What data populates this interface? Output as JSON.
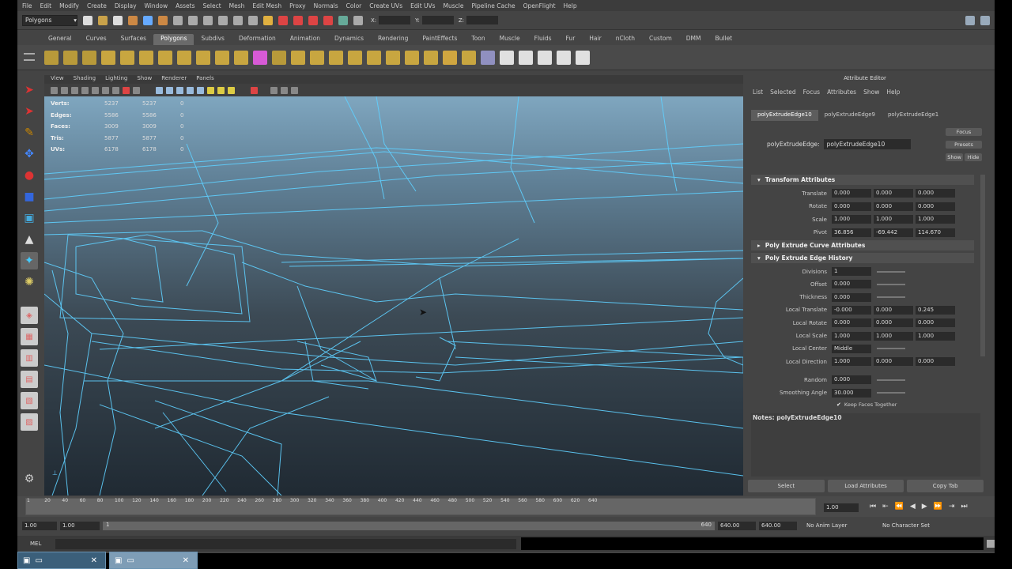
{
  "menubar": [
    "File",
    "Edit",
    "Modify",
    "Create",
    "Display",
    "Window",
    "Assets",
    "Select",
    "Mesh",
    "Edit Mesh",
    "Proxy",
    "Normals",
    "Color",
    "Create UVs",
    "Edit UVs",
    "Muscle",
    "Pipeline Cache",
    "OpenFlight",
    "Help"
  ],
  "status_line": {
    "mode": "Polygons",
    "x_label": "X:",
    "y_label": "Y:",
    "z_label": "Z:"
  },
  "shelf_tabs": [
    "General",
    "Curves",
    "Surfaces",
    "Polygons",
    "Subdivs",
    "Deformation",
    "Animation",
    "Dynamics",
    "Rendering",
    "PaintEffects",
    "Toon",
    "Muscle",
    "Fluids",
    "Fur",
    "Hair",
    "nCloth",
    "Custom",
    "DMM",
    "Bullet"
  ],
  "shelf_active": "Polygons",
  "shelf_icon_colors": [
    "#b89a3a",
    "#b89a3a",
    "#b89a3a",
    "#c8a640",
    "#c8a640",
    "#c8a640",
    "#c8a640",
    "#c8a640",
    "#c8a640",
    "#c8a640",
    "#c8a640",
    "#d75ad6",
    "#b89a3a",
    "#c8a640",
    "#c8a640",
    "#c8a640",
    "#c8a640",
    "#c8a640",
    "#c8a640",
    "#c8a640",
    "#c8a640",
    "#d0a640",
    "#c8a640",
    "#9090c0",
    "#e0e0e0",
    "#e0e0e0",
    "#e0e0e0",
    "#e0e0e0",
    "#e0e0e0"
  ],
  "viewport_menu": [
    "View",
    "Shading",
    "Lighting",
    "Show",
    "Renderer",
    "Panels"
  ],
  "hud": {
    "rows": [
      {
        "label": "Verts:",
        "a": "5237",
        "b": "5237",
        "c": "0"
      },
      {
        "label": "Edges:",
        "a": "5586",
        "b": "5586",
        "c": "0"
      },
      {
        "label": "Faces:",
        "a": "3009",
        "b": "3009",
        "c": "0"
      },
      {
        "label": "Tris:",
        "a": "5877",
        "b": "5877",
        "c": "0"
      },
      {
        "label": "UVs:",
        "a": "6178",
        "b": "6178",
        "c": "0"
      }
    ]
  },
  "attribute_editor": {
    "title": "Attribute Editor",
    "menu": [
      "List",
      "Selected",
      "Focus",
      "Attributes",
      "Show",
      "Help"
    ],
    "node_tabs": [
      "polyExtrudeEdge10",
      "polyExtrudeEdge9",
      "polyExtrudeEdge1"
    ],
    "node_label": "polyExtrudeEdge:",
    "node_value": "polyExtrudeEdge10",
    "buttons": [
      "Focus",
      "Presets",
      "Show",
      "Hide"
    ],
    "sections": {
      "transform": "Transform Attributes",
      "curve": "Poly Extrude Curve Attributes",
      "history": "Poly Extrude Edge History"
    },
    "transform_rows": [
      {
        "label": "Translate",
        "v": [
          "0.000",
          "0.000",
          "0.000"
        ]
      },
      {
        "label": "Rotate",
        "v": [
          "0.000",
          "0.000",
          "0.000"
        ]
      },
      {
        "label": "Scale",
        "v": [
          "1.000",
          "1.000",
          "1.000"
        ]
      },
      {
        "label": "Pivot",
        "v": [
          "36.856",
          "-69.442",
          "114.670"
        ]
      }
    ],
    "history_rows": [
      {
        "label": "Divisions",
        "v": [
          "1"
        ]
      },
      {
        "label": "Offset",
        "v": [
          "0.000"
        ]
      },
      {
        "label": "Thickness",
        "v": [
          "0.000"
        ]
      },
      {
        "label": "Local Translate",
        "v": [
          "-0.000",
          "0.000",
          "0.245"
        ]
      },
      {
        "label": "Local Rotate",
        "v": [
          "0.000",
          "0.000",
          "0.000"
        ]
      },
      {
        "label": "Local Scale",
        "v": [
          "1.000",
          "1.000",
          "1.000"
        ]
      },
      {
        "label": "Local Center",
        "v": [
          "Middle"
        ]
      },
      {
        "label": "Local Direction",
        "v": [
          "1.000",
          "0.000",
          "0.000"
        ]
      },
      {
        "label": "Random",
        "v": [
          "0.000"
        ]
      },
      {
        "label": "Smoothing Angle",
        "v": [
          "30.000"
        ]
      }
    ],
    "keep_faces": "Keep Faces Together",
    "notes_label": "Notes:",
    "notes_node": "polyExtrudeEdge10",
    "bottom_buttons": [
      "Select",
      "Load Attributes",
      "Copy Tab"
    ]
  },
  "time_slider": {
    "ticks": [
      "1",
      "20",
      "40",
      "60",
      "80",
      "100",
      "120",
      "140",
      "160",
      "180",
      "200",
      "220",
      "240",
      "260",
      "280",
      "300",
      "320",
      "340",
      "360",
      "380",
      "400",
      "420",
      "440",
      "460",
      "480",
      "500",
      "520",
      "540",
      "560",
      "580",
      "600",
      "620",
      "640"
    ],
    "current_frame": "1.00"
  },
  "range_slider": {
    "start": "1.00",
    "start2": "1.00",
    "handle_start": "1",
    "handle_end": "640",
    "end": "640.00",
    "end2": "640.00",
    "anim_layer": "No Anim Layer",
    "char_set": "No Character Set"
  },
  "command_line": {
    "label": "MEL"
  },
  "colors": {
    "wire": "#5fd0ff",
    "viewport_top": "#7fa6bf",
    "viewport_bottom": "#202a33",
    "taskbar": "#3b5f7a"
  }
}
